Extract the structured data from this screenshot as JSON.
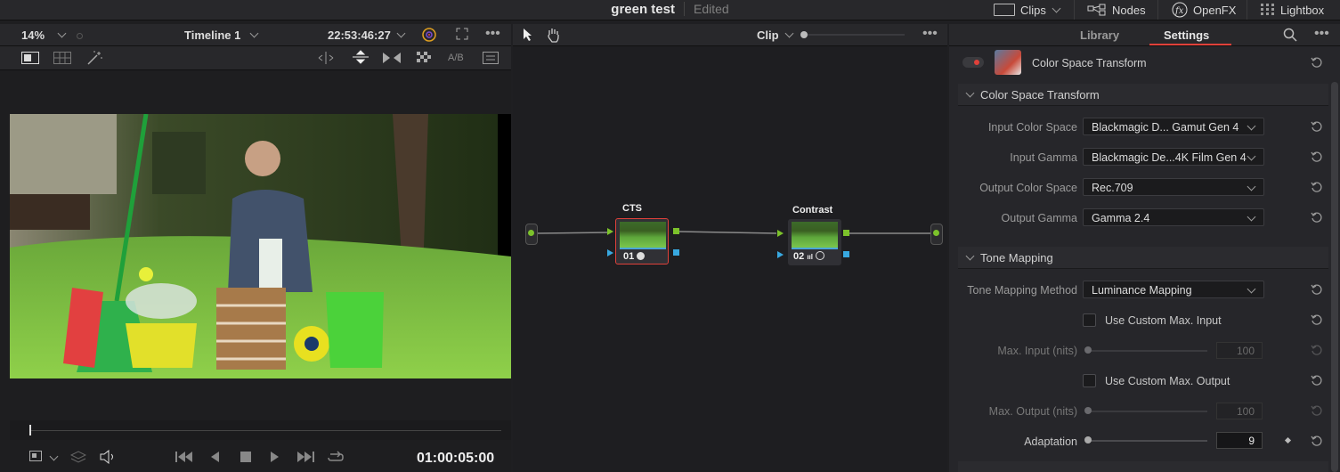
{
  "titlebar": {
    "project_name": "green test",
    "status": "Edited",
    "buttons": [
      {
        "label": "Clips"
      },
      {
        "label": "Nodes"
      },
      {
        "label": "OpenFX"
      },
      {
        "label": "Lightbox"
      }
    ]
  },
  "viewer": {
    "zoom": "14%",
    "timeline_name": "Timeline 1",
    "source_timecode": "22:53:46:27",
    "ab_label": "A/B",
    "timecode": "01:00:05:00"
  },
  "node_editor": {
    "mode": "Clip",
    "nodes": [
      {
        "label": "CTS",
        "number": "01"
      },
      {
        "label": "Contrast",
        "number": "02"
      }
    ]
  },
  "inspector": {
    "tabs": [
      {
        "label": "Library"
      },
      {
        "label": "Settings"
      }
    ],
    "active_tab": "Settings",
    "effect_name": "Color Space Transform",
    "section1": {
      "title": "Color Space Transform",
      "rows": [
        {
          "label": "Input Color Space",
          "value": "Blackmagic D... Gamut Gen 4"
        },
        {
          "label": "Input Gamma",
          "value": "Blackmagic De...4K Film Gen 4"
        },
        {
          "label": "Output Color Space",
          "value": "Rec.709"
        },
        {
          "label": "Output Gamma",
          "value": "Gamma 2.4"
        }
      ]
    },
    "section2": {
      "title": "Tone Mapping",
      "method_label": "Tone Mapping Method",
      "method_value": "Luminance Mapping",
      "custom_max_input_label": "Use Custom Max. Input",
      "max_input_label": "Max. Input (nits)",
      "max_input_value": "100",
      "custom_max_output_label": "Use Custom Max. Output",
      "max_output_label": "Max. Output (nits)",
      "max_output_value": "100",
      "adaptation_label": "Adaptation",
      "adaptation_value": "9"
    }
  },
  "colors": {
    "accent_red": "#e0413a",
    "node_green": "#7cc22b",
    "node_blue": "#38a8e0"
  }
}
